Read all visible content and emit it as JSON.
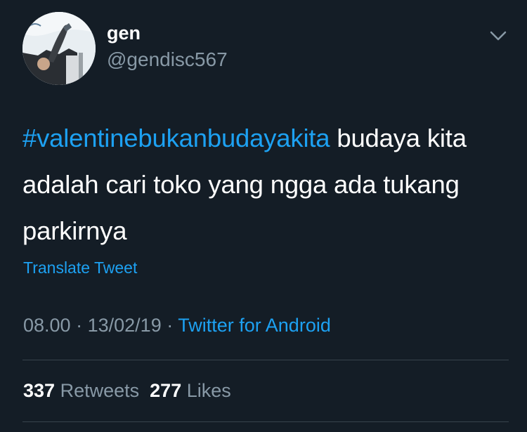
{
  "user": {
    "display_name": "gen",
    "handle": "@gendisc567"
  },
  "tweet": {
    "hashtag": "#valentinebukanbudayakita",
    "text": "budaya kita adalah cari toko yang ngga ada tukang parkirnya",
    "translate_label": "Translate Tweet",
    "time": "08.00",
    "date": "13/02/19",
    "separator": "·",
    "source": "Twitter for Android"
  },
  "stats": {
    "retweets_count": "337",
    "retweets_label": "Retweets",
    "likes_count": "277",
    "likes_label": "Likes"
  },
  "icons": {
    "menu_caret": "chevron-down-icon"
  },
  "colors": {
    "background": "#141d26",
    "accent": "#1da1f2",
    "secondary_text": "#8899a6",
    "divider": "#38444d"
  }
}
